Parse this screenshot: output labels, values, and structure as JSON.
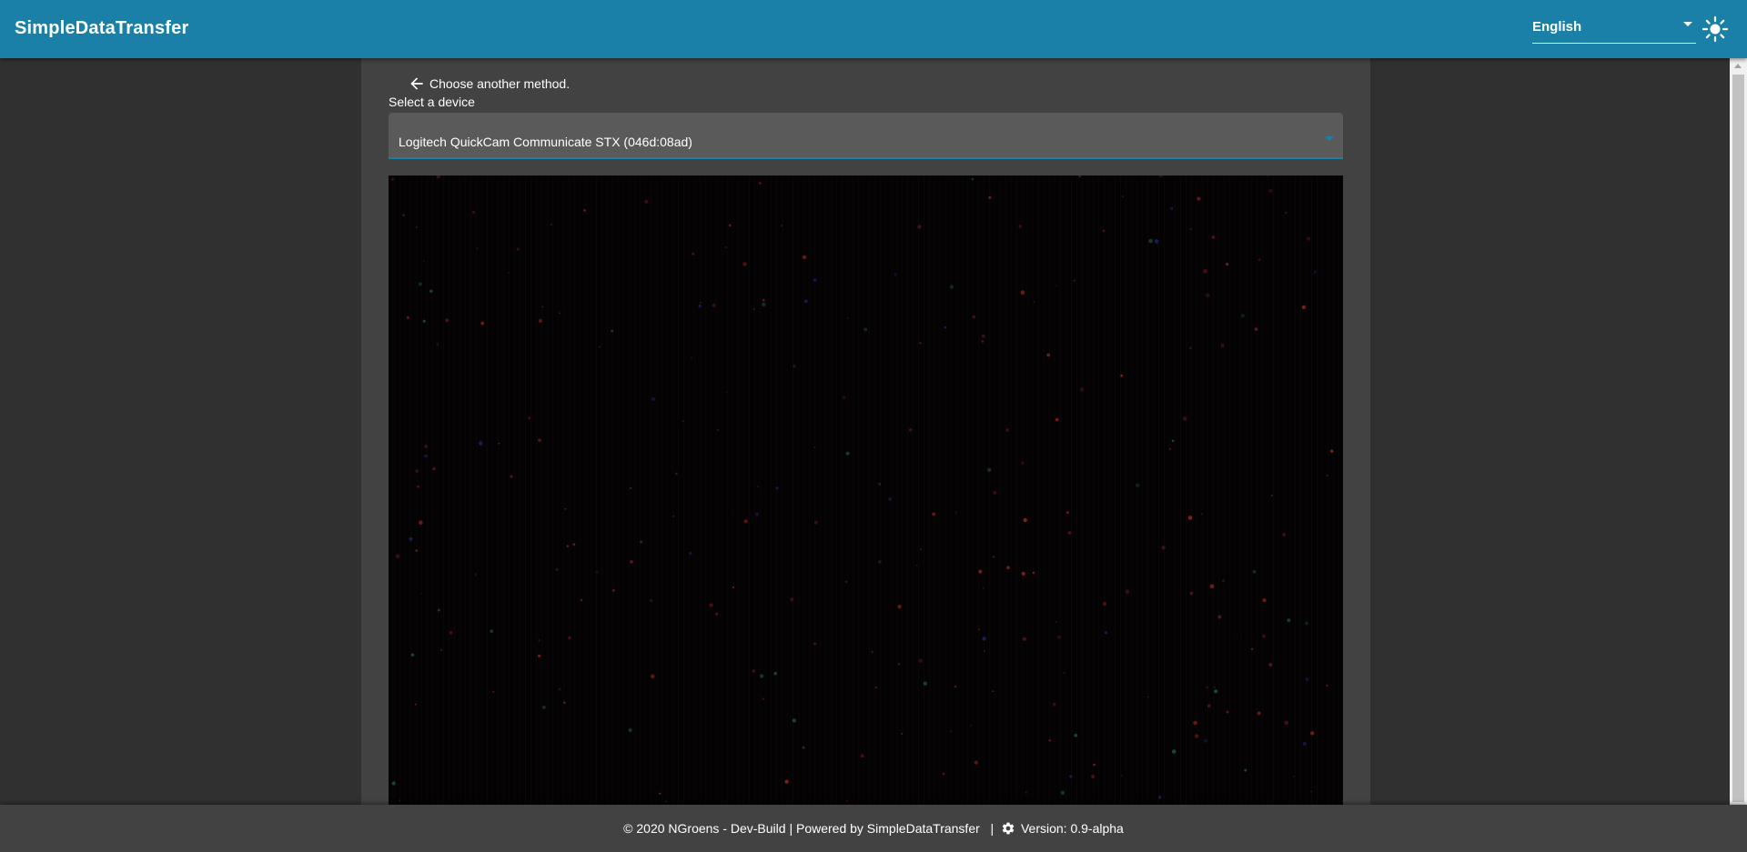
{
  "app": {
    "title": "SimpleDataTransfer"
  },
  "header": {
    "language": {
      "selected": "English"
    },
    "theme_icon": "sun-icon"
  },
  "main": {
    "back_link": {
      "icon": "arrow-left-icon",
      "label": "Choose another method."
    },
    "device_select": {
      "label": "Select a device",
      "selected": "Logitech QuickCam Communicate STX (046d:08ad)"
    }
  },
  "footer": {
    "text_left": "© 2020 NGroens - Dev-Build | Powered by SimpleDataTransfer   | ",
    "icon": "gear-icon",
    "text_right": "Version: 0.9-alpha"
  },
  "colors": {
    "appbar": "#1b80a8",
    "background": "#303030",
    "panel": "#424242",
    "select_field": "#5a5a5a",
    "accent": "#1b80a8"
  }
}
